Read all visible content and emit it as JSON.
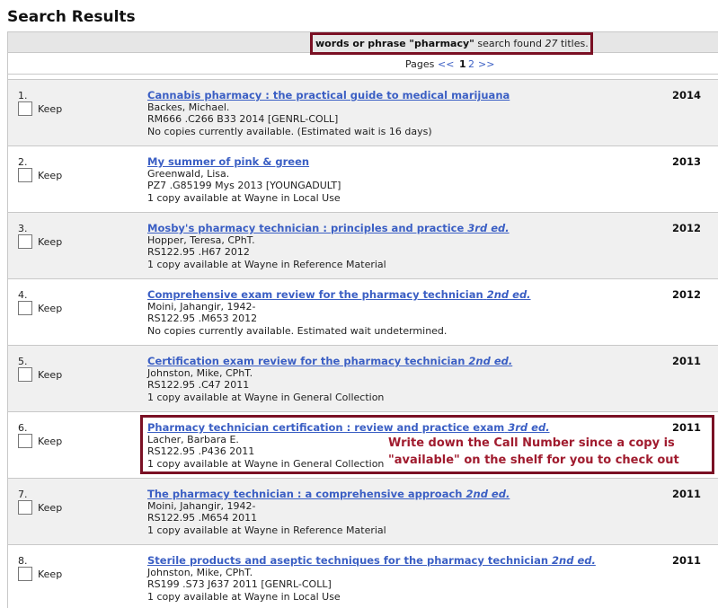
{
  "header": {
    "title": "Search Results"
  },
  "summary": {
    "prefix": "words or phrase",
    "term": "\"pharmacy\"",
    "middle": "search found",
    "count": "27",
    "suffix": "titles."
  },
  "pager": {
    "label": "Pages",
    "prev": "<<",
    "current": "1",
    "page2": "2",
    "next": ">>"
  },
  "keep_label": "Keep",
  "results": [
    {
      "num": "1.",
      "title": "Cannabis pharmacy : the practical guide to medical marijuana",
      "edition": "",
      "author": "Backes, Michael.",
      "call": "RM666 .C266 B33 2014 [GENRL-COLL]",
      "status": "No copies currently available. (Estimated wait is 16 days)",
      "year": "2014"
    },
    {
      "num": "2.",
      "title": "My summer of pink & green",
      "edition": "",
      "author": "Greenwald, Lisa.",
      "call": "PZ7 .G85199 Mys 2013 [YOUNGADULT]",
      "status": "1 copy available at Wayne in Local Use",
      "year": "2013"
    },
    {
      "num": "3.",
      "title": "Mosby's pharmacy technician : principles and practice",
      "edition": "3rd ed.",
      "author": "Hopper, Teresa, CPhT.",
      "call": "RS122.95 .H67 2012",
      "status": "1 copy available at Wayne in Reference Material",
      "year": "2012"
    },
    {
      "num": "4.",
      "title": "Comprehensive exam review for the pharmacy technician",
      "edition": "2nd ed.",
      "author": "Moini, Jahangir, 1942-",
      "call": "RS122.95 .M653 2012",
      "status": "No copies currently available. Estimated wait undetermined.",
      "year": "2012"
    },
    {
      "num": "5.",
      "title": "Certification exam review for the pharmacy technician",
      "edition": "2nd ed.",
      "author": "Johnston, Mike, CPhT.",
      "call": "RS122.95 .C47 2011",
      "status": "1 copy available at Wayne in General Collection",
      "year": "2011"
    },
    {
      "num": "6.",
      "title": "Pharmacy technician certification : review and practice exam",
      "edition": "3rd ed.",
      "author": "Lacher, Barbara E.",
      "call": "RS122.95 .P436 2011",
      "status": "1 copy available at Wayne in General Collection",
      "year": "2011"
    },
    {
      "num": "7.",
      "title": "The pharmacy technician : a comprehensive approach",
      "edition": "2nd ed.",
      "author": "Moini, Jahangir, 1942-",
      "call": "RS122.95 .M654 2011",
      "status": "1 copy available at Wayne in Reference Material",
      "year": "2011"
    },
    {
      "num": "8.",
      "title": "Sterile products and aseptic techniques for the pharmacy technician",
      "edition": "2nd ed.",
      "author": "Johnston, Mike, CPhT.",
      "call": "RS199 .S73 J637 2011 [GENRL-COLL]",
      "status": "1 copy available at Wayne in Local Use",
      "year": "2011"
    }
  ],
  "annotation": {
    "line1": "Write down the Call Number since a copy is",
    "line2": "\"available\" on the shelf for you to check out"
  },
  "colors": {
    "link": "#3b5fc4",
    "callout": "#7a1024",
    "annotation_text": "#a01b2e"
  }
}
